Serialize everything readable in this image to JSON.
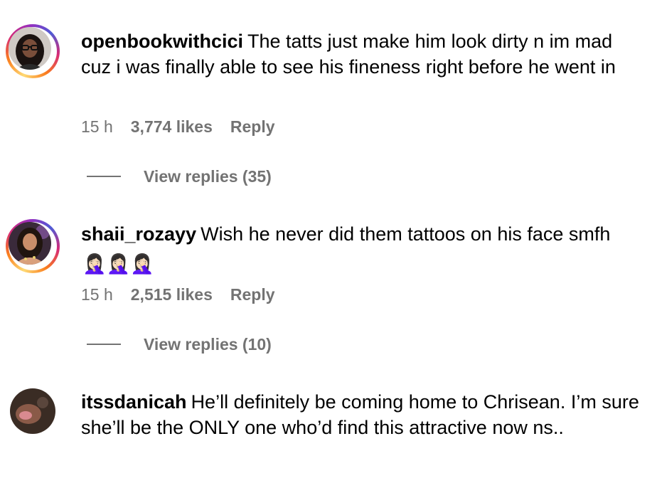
{
  "comments": [
    {
      "username": "openbookwithcici",
      "text": "The tatts just make him look dirty n im mad cuz i was finally able to see his fineness right before he went in",
      "time": "15 h",
      "likes": "3,774 likes",
      "reply_label": "Reply",
      "view_replies": "View replies (35)",
      "has_story_ring": true
    },
    {
      "username": "shaii_rozayy",
      "text": "Wish he never did them tattoos on his face smfh",
      "emoji": "🤦🏻‍♀️🤦🏻‍♀️🤦🏻‍♀️",
      "time": "15 h",
      "likes": "2,515 likes",
      "reply_label": "Reply",
      "view_replies": "View replies (10)",
      "has_story_ring": true
    },
    {
      "username": "itssdanicah",
      "text": "He’ll definitely be coming home to Chrisean. I’m sure she’ll be the ONLY one who’d find this attractive now ns..",
      "has_story_ring": false
    }
  ],
  "colors": {
    "secondary_text": "#737373",
    "story_ring": [
      "#feda75",
      "#fa7e1e",
      "#d62976",
      "#962fbf",
      "#4f5bd5"
    ]
  }
}
